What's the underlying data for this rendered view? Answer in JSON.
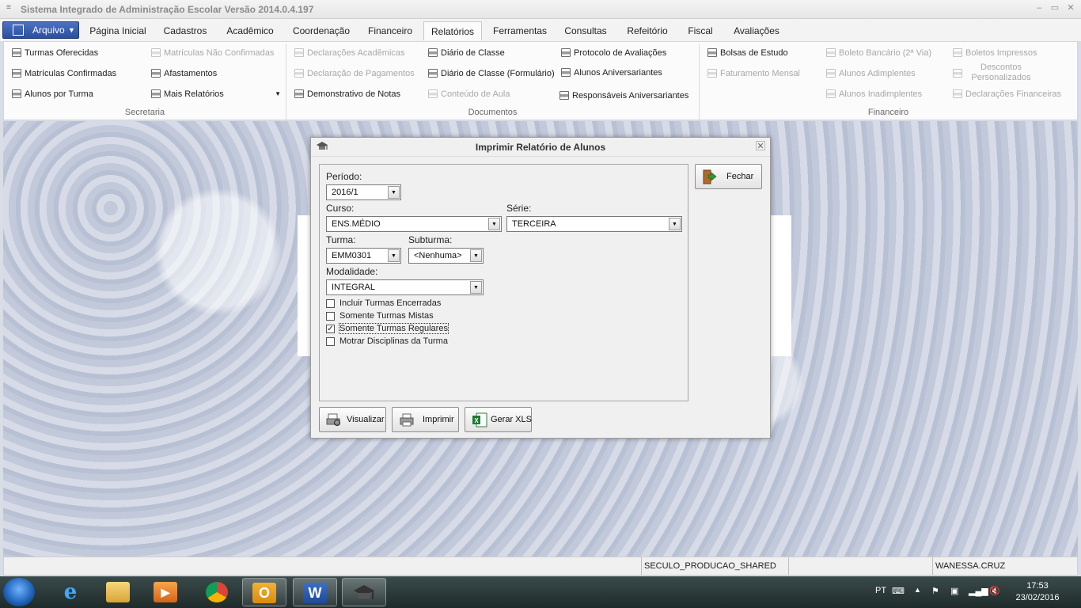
{
  "window": {
    "title": "Sistema Integrado de Administração Escolar Versão 2014.0.4.197"
  },
  "menu": {
    "arquivo": "Arquivo",
    "tabs": [
      "Página Inicial",
      "Cadastros",
      "Acadêmico",
      "Coordenação",
      "Financeiro",
      "Relatórios",
      "Ferramentas",
      "Consultas",
      "Refeitório",
      "Fiscal",
      "Avaliações"
    ],
    "active_tab": "Relatórios"
  },
  "ribbon": {
    "secretaria": {
      "group": "Secretaria",
      "items": [
        "Turmas Oferecidas",
        "Matrículas Confirmadas",
        "Alunos por Turma",
        "Matrículas Não Confirmadas",
        "Afastamentos",
        "Mais Relatórios"
      ]
    },
    "documentos": {
      "group": "Documentos",
      "items": [
        "Declarações Acadêmicas",
        "Declaração de Pagamentos",
        "Demonstrativo de Notas",
        "Diário de Classe",
        "Diário de Classe (Formulário)",
        "Conteúdo de Aula",
        "Protocolo de Avaliações",
        "Alunos Aniversariantes",
        "Responsáveis Aniversariantes"
      ]
    },
    "financeiro": {
      "group": "Financeiro",
      "items": [
        "Bolsas de Estudo",
        "Faturamento Mensal",
        "Boleto Bancário (2ª Via)",
        "Alunos Adimplentes",
        "Alunos Inadimplentes",
        "Boletos Impressos",
        "Descontos Personalizados",
        "Declarações Financeiras"
      ]
    }
  },
  "dialog": {
    "title": "Imprimir Relatório de Alunos",
    "close_label": "Fechar",
    "periodo": {
      "label": "Período:",
      "value": "2016/1"
    },
    "curso": {
      "label": "Curso:",
      "value": "ENS.MÉDIO"
    },
    "serie": {
      "label": "Série:",
      "value": "TERCEIRA"
    },
    "turma": {
      "label": "Turma:",
      "value": "EMM0301"
    },
    "subturma": {
      "label": "Subturma:",
      "value": "<Nenhuma>"
    },
    "modalidade": {
      "label": "Modalidade:",
      "value": "INTEGRAL"
    },
    "checkboxes": [
      {
        "label": "Incluir Turmas Encerradas",
        "checked": false
      },
      {
        "label": "Somente Turmas Mistas",
        "checked": false
      },
      {
        "label": "Somente Turmas Regulares",
        "checked": true
      },
      {
        "label": "Motrar Disciplinas da Turma",
        "checked": false
      }
    ],
    "buttons": {
      "visualizar": "Visualizar",
      "imprimir": "Imprimir",
      "gerar_xls": "Gerar XLS"
    }
  },
  "statusbar": {
    "database": "SECULO_PRODUCAO_SHARED",
    "user": "WANESSA.CRUZ"
  },
  "taskbar": {
    "language": "PT",
    "time": "17:53",
    "date": "23/02/2016",
    "apps": [
      "internet-explorer",
      "file-explorer",
      "media-player",
      "chrome",
      "outlook",
      "word",
      "sistema-escolar"
    ]
  }
}
